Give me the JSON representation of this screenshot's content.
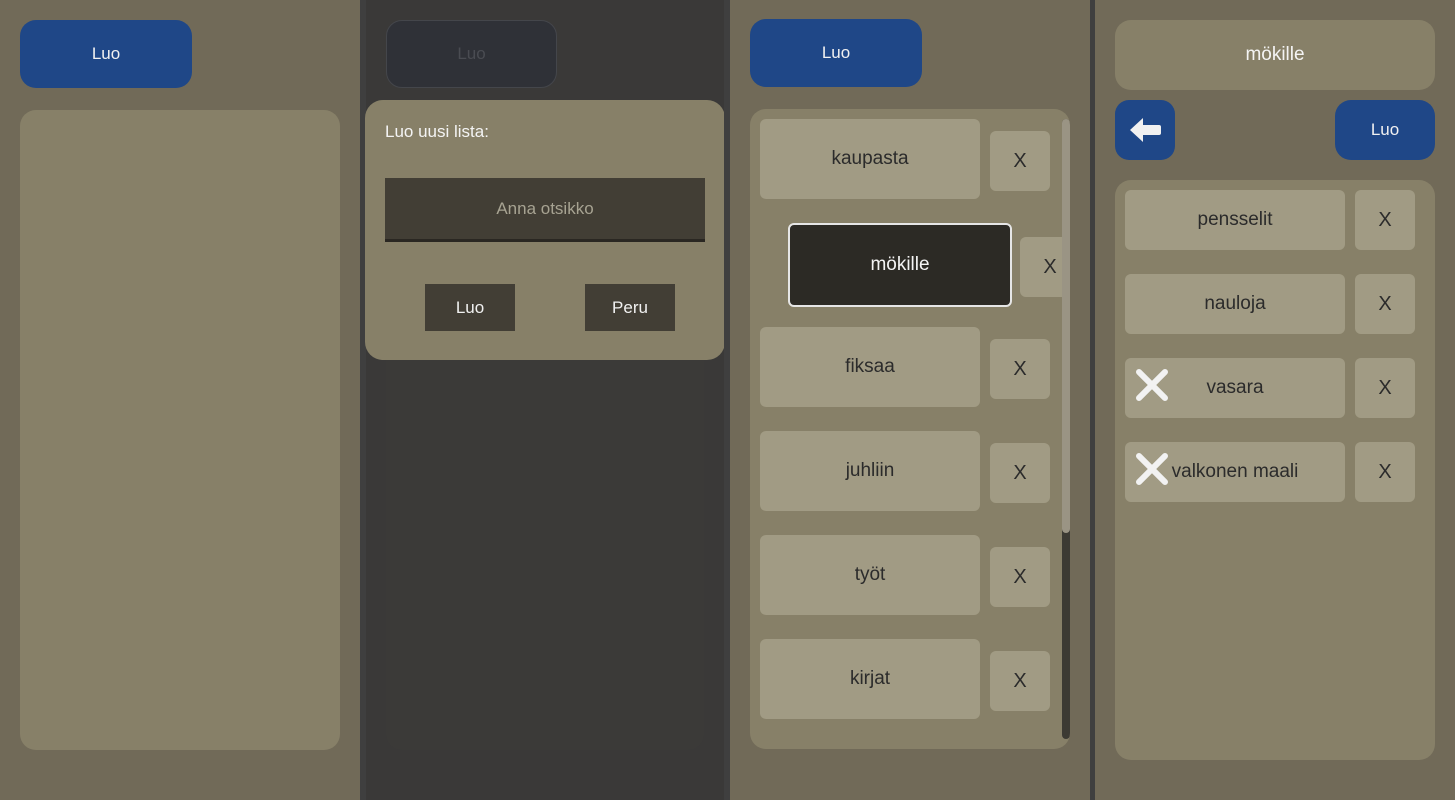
{
  "panel1": {
    "create_label": "Luo"
  },
  "panel2": {
    "create_label": "Luo",
    "dialog": {
      "title": "Luo uusi lista:",
      "input_placeholder": "Anna otsikko",
      "create_label": "Luo",
      "cancel_label": "Peru"
    }
  },
  "panel3": {
    "create_label": "Luo",
    "lists": [
      {
        "label": "kaupasta",
        "delete": "X"
      },
      {
        "label": "mökille",
        "delete": "X",
        "selected": true
      },
      {
        "label": "fiksaa",
        "delete": "X"
      },
      {
        "label": "juhliin",
        "delete": "X"
      },
      {
        "label": "työt",
        "delete": "X"
      },
      {
        "label": "kirjat",
        "delete": "X"
      }
    ]
  },
  "panel4": {
    "title": "mökille",
    "back_icon": "arrow-left-icon",
    "create_label": "Luo",
    "items": [
      {
        "label": "pensselit",
        "delete": "X",
        "checked": false
      },
      {
        "label": "nauloja",
        "delete": "X",
        "checked": false
      },
      {
        "label": "vasara",
        "delete": "X",
        "checked": true
      },
      {
        "label": "valkonen maali",
        "delete": "X",
        "checked": true
      }
    ]
  },
  "colors": {
    "background": "#716a58",
    "list_box": "#878068",
    "item": "#a19b84",
    "accent_blue": "#1f4787",
    "overlay": "#3a3938",
    "divider": "#3f3f3f"
  }
}
